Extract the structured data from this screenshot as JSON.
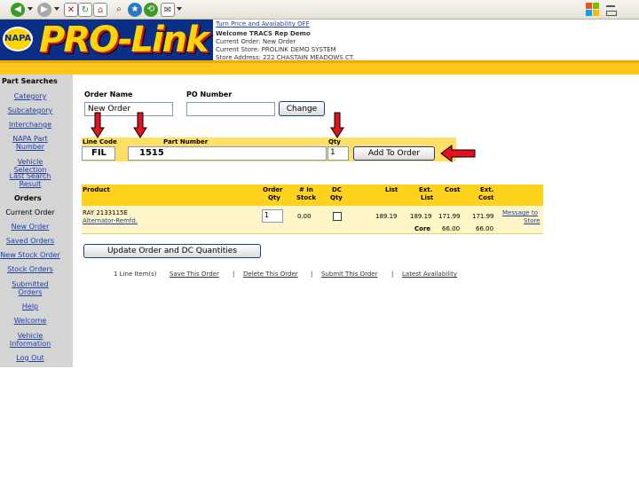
{
  "header": {
    "turn_price": "Turn Price and Availability OFF",
    "welcome": "Welcome TRACS Rep Demo",
    "current_order": "Current Order: New Order",
    "current_store": "Current Store: PROLINK DEMO SYSTEM",
    "store_address": "Store Address: 222 CHASTAIN MEADOWS CT.",
    "napa_logo_text": "NAPA",
    "prolink_logo_text": "PRO-Link"
  },
  "sidebar": {
    "part_searches": "Part Searches",
    "category": "Category",
    "subcategory": "Subcategory",
    "interchange": "Interchange",
    "napa_part_number_1": "NAPA Part",
    "napa_part_number_2": "Number",
    "vehicle_selection": "Vehicle Selection",
    "last_search_1": "Last Search",
    "last_search_2": "Result",
    "orders": "Orders",
    "current_order": "Current Order",
    "new_order": "New Order",
    "saved_orders": "Saved Orders",
    "new_stock_order": "New Stock Order",
    "stock_orders": "Stock Orders",
    "submitted_orders_1": "Submitted",
    "submitted_orders_2": "Orders",
    "help": "Help",
    "welcome": "Welcome",
    "vehicle_information_1": "Vehicle",
    "vehicle_information_2": "Information",
    "log_out": "Log Out"
  },
  "order_form": {
    "order_name_label": "Order Name",
    "order_name_value": "New Order",
    "po_number_label": "PO Number",
    "po_number_value": "",
    "change_button": "Change"
  },
  "add_part": {
    "line_code_label": "Line Code",
    "part_number_label": "Part Number",
    "qty_label": "Qty",
    "line_code_value": "FIL",
    "part_number_value": "1515",
    "qty_value": "1",
    "add_button": "Add To Order"
  },
  "table": {
    "headers": {
      "product": "Product",
      "order_qty_1": "Order",
      "order_qty_2": "Qty",
      "in_stock_1": "# In",
      "in_stock_2": "Stock",
      "dc_qty_1": "DC",
      "dc_qty_2": "Qty",
      "list": "List",
      "ext_list_1": "Ext.",
      "ext_list_2": "List",
      "cost": "Cost",
      "ext_cost_1": "Ext.",
      "ext_cost_2": "Cost"
    },
    "row": {
      "part": "RAY 2133115E",
      "description": "Alternator-Remfd.",
      "order_qty": "1",
      "in_stock": "0.00",
      "list": "189.19",
      "ext_list": "189.19",
      "cost": "171.99",
      "ext_cost": "171.99",
      "message_1": "Message to",
      "message_2": "Store",
      "core_label": "Core",
      "core_cost": "66.00",
      "core_ext_cost": "66.00"
    }
  },
  "update_button": "Update Order and DC Quantities",
  "footer": {
    "line_items": "1 Line Item(s)",
    "save": "Save This Order",
    "delete": "Delete This Order",
    "submit": "Submit This Order",
    "latest": "Latest Availability",
    "sep": "|"
  },
  "colors": {
    "accent_yellow": "#ffd21e",
    "arrow_red": "#e3101e",
    "napa_blue": "#0b2f86"
  }
}
